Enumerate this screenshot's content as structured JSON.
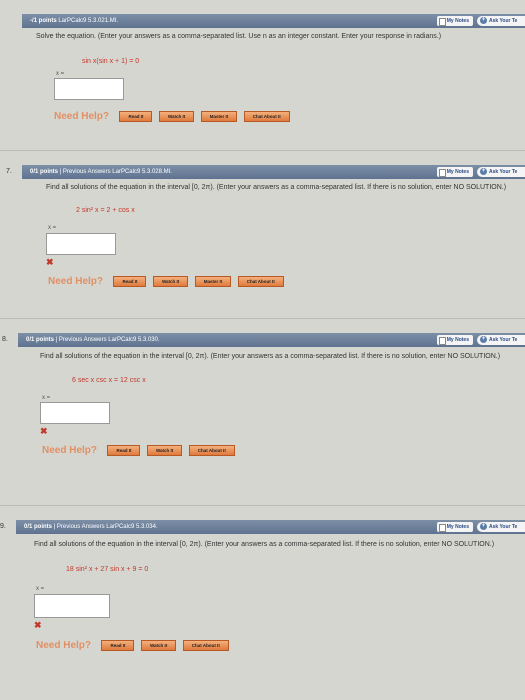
{
  "problems": [
    {
      "number": "",
      "points": "-/1 points",
      "meta": "LarPCalc9 5.3.021.MI.",
      "my_notes": "My Notes",
      "ask": "Ask Your Te",
      "instructions": "Solve the equation. (Enter your answers as a comma-separated list. Use n as an integer constant. Enter your response in radians.)",
      "equation": [
        "sin x(sin x + 1) = 0"
      ],
      "answer_label": "x =",
      "answer_value": "",
      "need_help": "Need Help?",
      "help_buttons": [
        "Read It",
        "Watch It",
        "Master It",
        "Chat About It"
      ]
    },
    {
      "number": "7.",
      "points": "0/1 points",
      "meta": "| Previous Answers   LarPCalc9 5.3.028.MI.",
      "my_notes": "My Notes",
      "ask": "Ask Your Te",
      "instructions": "Find all solutions of the equation in the interval [0, 2π). (Enter your answers as a comma-separated list. If there is no solution, enter NO SOLUTION.)",
      "equation": [
        "2 sin² x = 2 + cos x"
      ],
      "answer_label": "x =",
      "answer_value": "",
      "status": "✖",
      "need_help": "Need Help?",
      "help_buttons": [
        "Read It",
        "Watch It",
        "Master It",
        "Chat About It"
      ]
    },
    {
      "number": "8.",
      "points": "0/1 points",
      "meta": "| Previous Answers   LarPCalc9 5.3.030.",
      "my_notes": "My Notes",
      "ask": "Ask Your Te",
      "instructions": "Find all solutions of the equation in the interval [0, 2π). (Enter your answers as a comma-separated list. If there is no solution, enter NO SOLUTION.)",
      "equation": [
        "6 sec x csc x = 12 csc x"
      ],
      "answer_label": "x =",
      "answer_value": "",
      "status": "✖",
      "need_help": "Need Help?",
      "help_buttons": [
        "Read It",
        "Watch It",
        "Chat About It"
      ]
    },
    {
      "number": "9.",
      "points": "0/1 points",
      "meta": "| Previous Answers   LarPCalc9 5.3.034.",
      "my_notes": "My Notes",
      "ask": "Ask Your Te",
      "instructions": "Find all solutions of the equation in the interval [0, 2π). (Enter your answers as a comma-separated list. If there is no solution, enter NO SOLUTION.)",
      "equation": [
        "18 sin² x + 27 sin x + 9 = 0"
      ],
      "answer_label": "x =",
      "answer_value": "",
      "status": "✖",
      "need_help": "Need Help?",
      "help_buttons": [
        "Read It",
        "Watch It",
        "Chat About It"
      ]
    }
  ]
}
